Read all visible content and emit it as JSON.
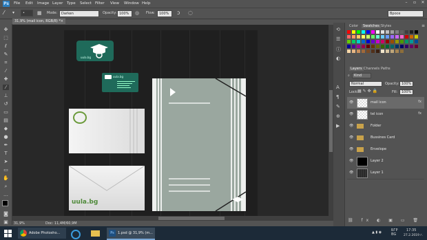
{
  "app": {
    "logo": "Ps",
    "menu": [
      "File",
      "Edit",
      "Image",
      "Layer",
      "Type",
      "Select",
      "Filter",
      "View",
      "Window",
      "Help"
    ]
  },
  "options": {
    "mode_label": "Mode:",
    "mode_value": "Darken",
    "opacity_label": "Opacity:",
    "opacity_value": "100%",
    "flow_label": "Flow:",
    "flow_value": "100%",
    "workspace": "Bpoce"
  },
  "document": {
    "tab_title": "31,9% (mail icon, RGB/8) *",
    "zoom": "31,9%",
    "doc_info": "Doc: 11,4M/60,9M"
  },
  "swatches_panel": {
    "tabs": [
      "Color",
      "Swatches",
      "Styles"
    ],
    "colors": [
      "#ff0000",
      "#ffff00",
      "#00ff00",
      "#00ffff",
      "#0000ff",
      "#ff00ff",
      "#ffffff",
      "#e0e0e0",
      "#c0c0c0",
      "#a0a0a0",
      "#808080",
      "#606060",
      "#404040",
      "#202020",
      "#000000",
      "#ff6666",
      "#ff9966",
      "#ffcc66",
      "#ffff66",
      "#ccff66",
      "#66ff66",
      "#66ffcc",
      "#66ccff",
      "#6699ff",
      "#9966ff",
      "#cc66ff",
      "#ff66cc",
      "#cc0000",
      "#cc6600",
      "#cccc00",
      "#66cc00",
      "#00cc66",
      "#00cccc",
      "#0066cc",
      "#0000cc",
      "#6600cc",
      "#cc00cc",
      "#cc0066",
      "#990000",
      "#994c00",
      "#999900",
      "#4c9900",
      "#009966",
      "#009999",
      "#004c99",
      "#000099",
      "#4c0099",
      "#990099",
      "#99004c",
      "#660000",
      "#663300",
      "#666600",
      "#336600",
      "#006633",
      "#006666",
      "#003366",
      "#000066",
      "#330066",
      "#660066",
      "#660033",
      "#f7d7a8",
      "#e8b784",
      "#c98f5c",
      "#a0693a",
      "#7a4a24",
      "#52301a",
      "#3a2010",
      "#f2e6cc",
      "#d9c7a3",
      "#bfa67a",
      "#a68552",
      "#8c6e3a"
    ]
  },
  "layers_panel": {
    "tabs": [
      "Layers",
      "Channels",
      "Paths"
    ],
    "kind_label": "Kind",
    "blend_mode": "Normal",
    "opacity_label": "Opacity:",
    "opacity_value": "100%",
    "lock_label": "Lock:",
    "fill_label": "Fill:",
    "fill_value": "100%",
    "layers": [
      {
        "name": "mail icon",
        "type": "smart",
        "selected": true
      },
      {
        "name": "tel icon",
        "type": "smart",
        "selected": false
      },
      {
        "name": "Folder",
        "type": "group",
        "selected": false
      },
      {
        "name": "Bussines Card",
        "type": "group",
        "selected": false
      },
      {
        "name": "Envelope",
        "type": "group",
        "selected": false
      },
      {
        "name": "Layer 2",
        "type": "black",
        "selected": false
      },
      {
        "name": "Layer 1",
        "type": "wood",
        "selected": false
      }
    ]
  },
  "mockup": {
    "brand_text": "uula.bg"
  },
  "taskbar": {
    "ps_task_label": "1.psd @ 31,9% (m...",
    "chrome_task_label": "Adobe Photosho...",
    "lang": "БГР\nBG",
    "time": "17:35",
    "date": "27.2.2019 г."
  },
  "colors": {
    "accent_green": "#1f6a5a",
    "folder_green": "#9aa79f",
    "panel_bg": "#535353",
    "taskbar_bg": "#1c2a38"
  }
}
